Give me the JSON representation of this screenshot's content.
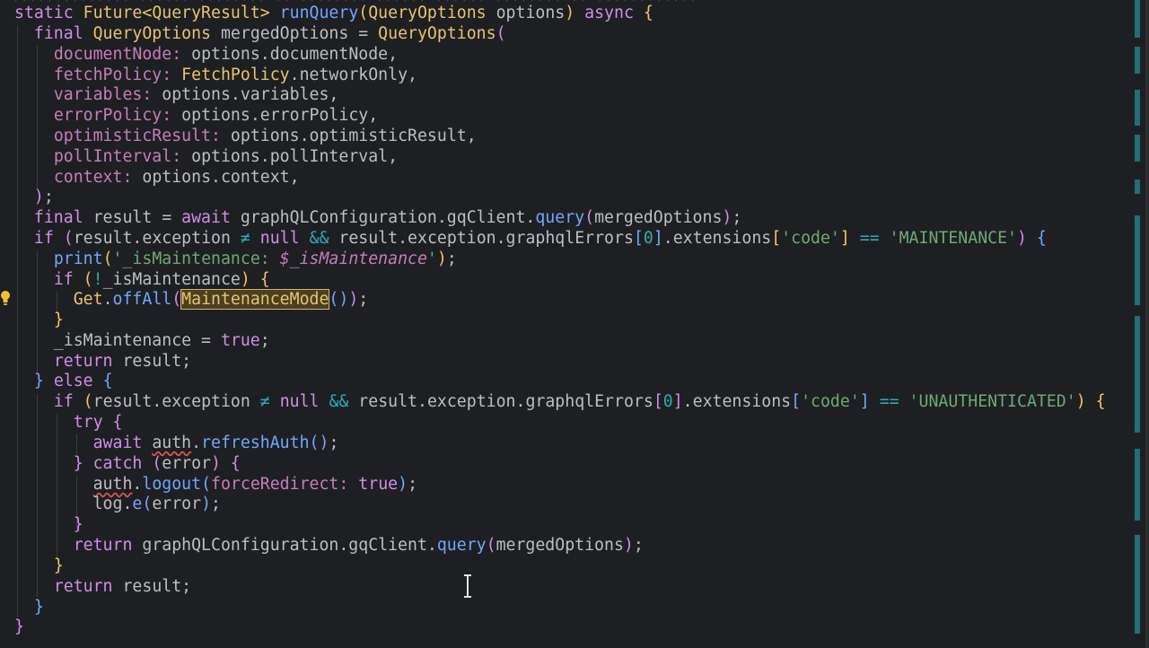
{
  "editor": {
    "top_fade_text": "///// //////// ////// //////// // //////// ////// ////// //////// // ////////////",
    "lines": [
      "static Future<QueryResult> runQuery(QueryOptions options) async {",
      "final QueryOptions mergedOptions = QueryOptions(",
      "documentNode: options.documentNode,",
      "fetchPolicy: FetchPolicy.networkOnly,",
      "variables: options.variables,",
      "errorPolicy: options.errorPolicy,",
      "optimisticResult: options.optimisticResult,",
      "pollInterval: options.pollInterval,",
      "context: options.context,",
      ");",
      "final result = await graphQLConfiguration.gqClient.query(mergedOptions);",
      "if (result.exception ≠ null && result.exception.graphqlErrors[0].extensions['code'] == 'MAINTENANCE') {",
      "print('_isMaintenance: $_isMaintenance');",
      "if (!_isMaintenance) {",
      "Get.offAll(MaintenanceMode());",
      "}",
      "_isMaintenance = true;",
      "return result;",
      "} else {",
      "if (result.exception ≠ null && result.exception.graphqlErrors[0].extensions['code'] == 'UNAUTHENTICATED') {",
      "try {",
      "await auth.refreshAuth();",
      "} catch (error) {",
      "auth.logout(forceRedirect: true);",
      "log.e(error);",
      "}",
      "return graphQLConfiguration.gqClient.query(mergedOptions);",
      "}",
      "return result;",
      "}",
      "}"
    ]
  },
  "colors": {
    "background": "#1e1f22",
    "keyword": "#cf8ee8",
    "type": "#e8c46a",
    "method": "#6fa8ff",
    "string": "#6aab73",
    "number": "#2aacb8",
    "scroll_mark": "#1f6f79"
  },
  "icons": {
    "gutter": "lightbulb-icon",
    "cursor": "text-cursor-icon"
  }
}
